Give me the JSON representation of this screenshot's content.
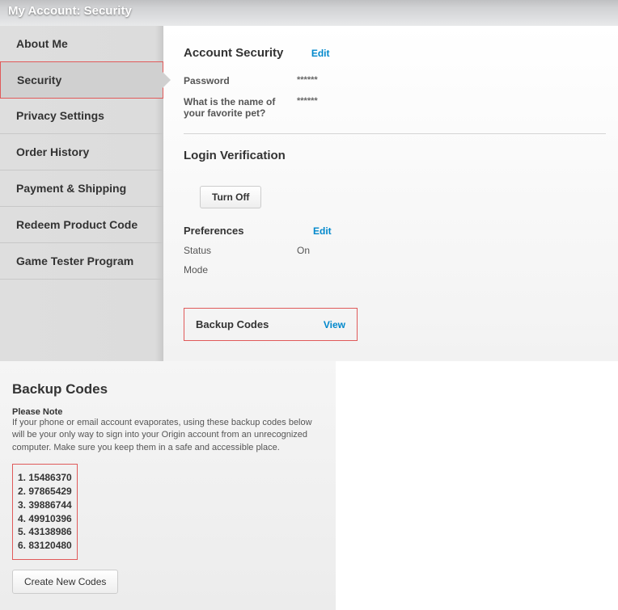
{
  "header": {
    "title": "My Account: Security"
  },
  "sidebar": {
    "items": [
      {
        "label": "About Me"
      },
      {
        "label": "Security",
        "active": true
      },
      {
        "label": "Privacy Settings"
      },
      {
        "label": "Order History"
      },
      {
        "label": "Payment & Shipping"
      },
      {
        "label": "Redeem Product Code"
      },
      {
        "label": "Game Tester Program"
      }
    ]
  },
  "account_security": {
    "title": "Account Security",
    "edit_label": "Edit",
    "password_label": "Password",
    "password_value": "******",
    "question_label": "What is the name of your favorite pet?",
    "question_value": "******"
  },
  "login_verification": {
    "title": "Login Verification",
    "turn_off_label": "Turn Off"
  },
  "preferences": {
    "title": "Preferences",
    "edit_label": "Edit",
    "status_label": "Status",
    "status_value": "On",
    "mode_label": "Mode"
  },
  "backup_codes_section": {
    "title": "Backup Codes",
    "view_label": "View"
  },
  "backup_codes_panel": {
    "heading": "Backup Codes",
    "note_title": "Please Note",
    "note_text": "If your phone or email account evaporates, using these backup codes below will be your only way to sign into your Origin account from an unrecognized computer. Make sure you keep them in a safe and accessible place.",
    "codes": [
      {
        "display": "1. 15486370"
      },
      {
        "display": "2. 97865429"
      },
      {
        "display": "3. 39886744"
      },
      {
        "display": "4. 49910396"
      },
      {
        "display": "5. 43138986"
      },
      {
        "display": "6. 83120480"
      }
    ],
    "create_label": "Create New Codes"
  }
}
